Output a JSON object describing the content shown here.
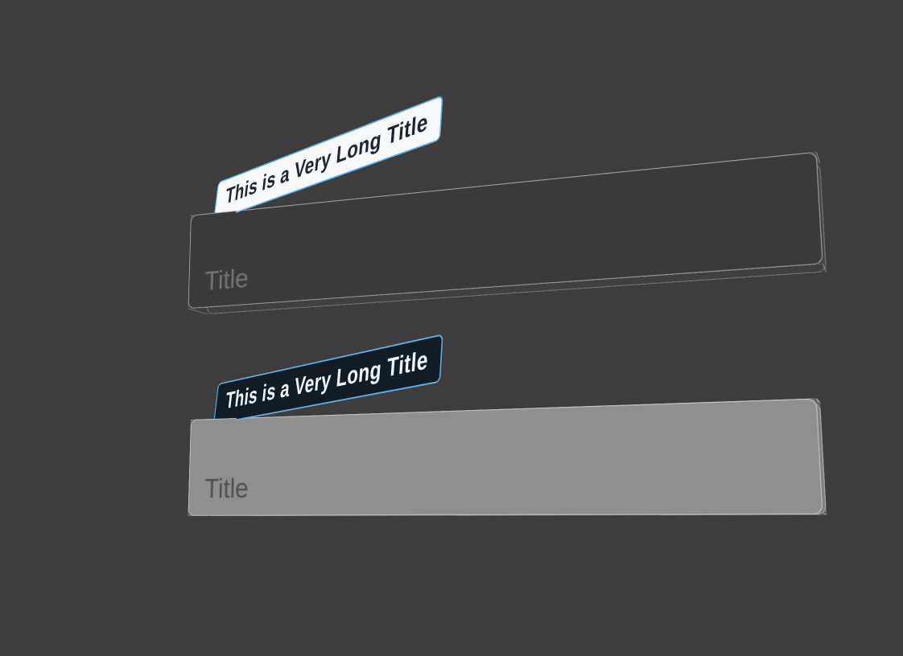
{
  "variants": {
    "dark": {
      "tooltip": "This is a Very Long Title",
      "placeholder": "Title"
    },
    "light": {
      "tooltip": "This is a Very Long Title",
      "placeholder": "Title"
    }
  }
}
